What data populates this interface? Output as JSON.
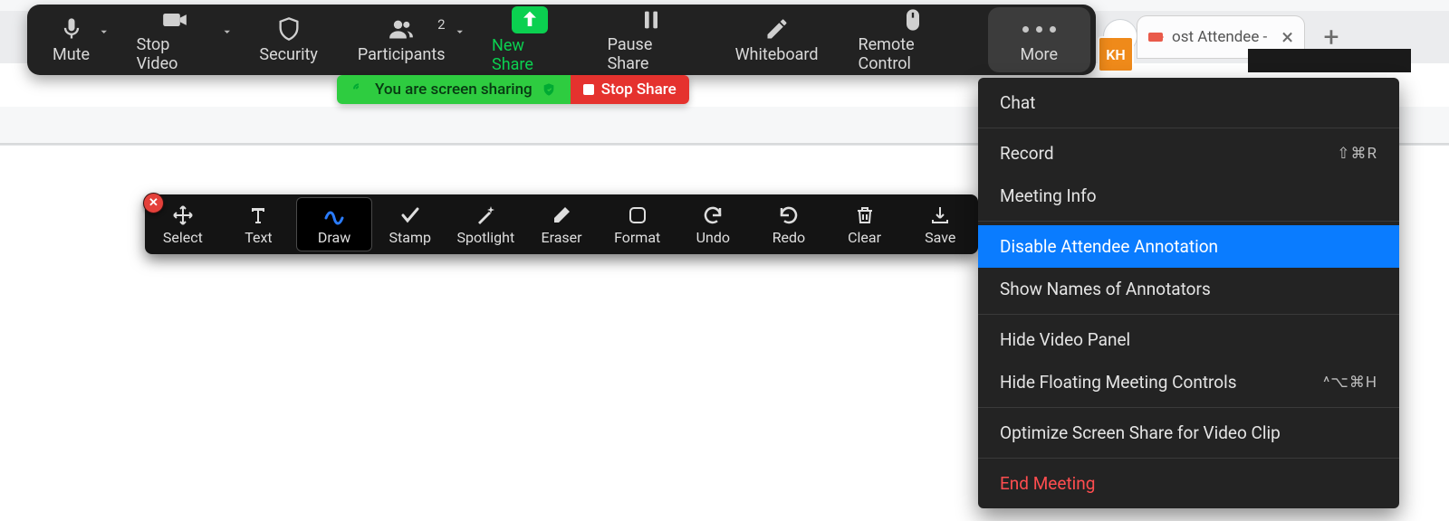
{
  "toolbar": {
    "mute": "Mute",
    "stop_video": "Stop Video",
    "security": "Security",
    "participants": "Participants",
    "participants_count": "2",
    "new_share": "New Share",
    "pause_share": "Pause Share",
    "whiteboard": "Whiteboard",
    "remote_control": "Remote Control",
    "more": "More"
  },
  "share_bar": {
    "status": "You are screen sharing",
    "stop": "Stop Share"
  },
  "more_menu": {
    "chat": "Chat",
    "record": "Record",
    "record_shortcut": "⇧⌘R",
    "meeting_info": "Meeting Info",
    "disable_anno": "Disable Attendee Annotation",
    "show_names": "Show Names of Annotators",
    "hide_video": "Hide Video Panel",
    "hide_floating": "Hide Floating Meeting Controls",
    "hide_floating_shortcut": "^⌥⌘H",
    "optimize": "Optimize Screen Share for Video Clip",
    "end": "End Meeting"
  },
  "annotation": {
    "select": "Select",
    "text": "Text",
    "draw": "Draw",
    "stamp": "Stamp",
    "spotlight": "Spotlight",
    "eraser": "Eraser",
    "format": "Format",
    "undo": "Undo",
    "redo": "Redo",
    "clear": "Clear",
    "save": "Save"
  },
  "tab": {
    "title_fragment": "ost Attendee -",
    "avatar": "KH"
  },
  "colors": {
    "accent_green": "#2ecc40",
    "stop_red": "#e5322e",
    "menu_highlight": "#0a7cff",
    "end_red": "#ff4d4f"
  }
}
